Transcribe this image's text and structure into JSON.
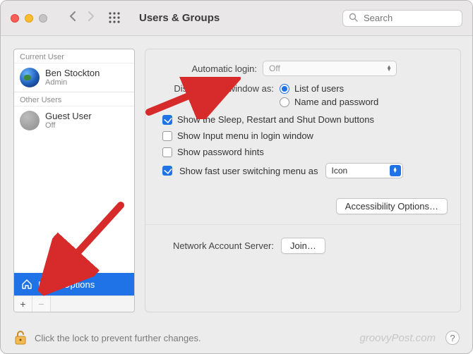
{
  "titlebar": {
    "title": "Users & Groups",
    "search_placeholder": "Search"
  },
  "sidebar": {
    "current_label": "Current User",
    "other_label": "Other Users",
    "current_user": {
      "name": "Ben Stockton",
      "role": "Admin"
    },
    "other_user": {
      "name": "Guest User",
      "role": "Off"
    },
    "login_options_label": "Login Options",
    "add_label": "+",
    "remove_label": "−"
  },
  "panel": {
    "auto_login_label": "Automatic login:",
    "auto_login_value": "Off",
    "display_label": "Display login window as:",
    "radio_list": "List of users",
    "radio_namepw": "Name and password",
    "check_sleep": "Show the Sleep, Restart and Shut Down buttons",
    "check_input": "Show Input menu in login window",
    "check_hints": "Show password hints",
    "check_fast": "Show fast user switching menu as",
    "fast_select_value": "Icon",
    "accessibility_btn": "Accessibility Options…",
    "nas_label": "Network Account Server:",
    "nas_btn": "Join…"
  },
  "footer": {
    "lock_text": "Click the lock to prevent further changes.",
    "watermark": "groovyPost.com",
    "help": "?"
  }
}
